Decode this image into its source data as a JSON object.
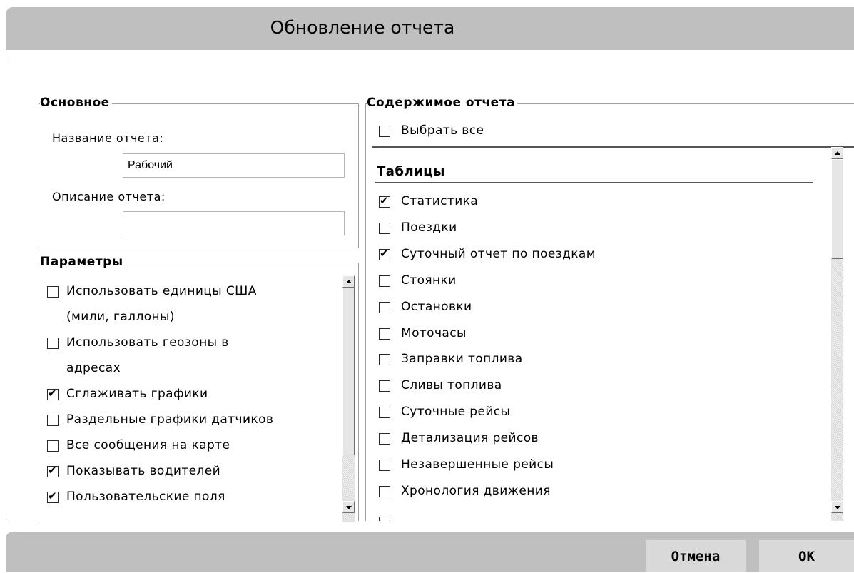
{
  "dialog": {
    "title": "Обновление отчета"
  },
  "basic": {
    "legend": "Основное",
    "name_label": "Название отчета:",
    "name_value": "Рабочий",
    "desc_label": "Описание отчета:",
    "desc_value": ""
  },
  "params": {
    "legend": "Параметры",
    "items": [
      {
        "label": "Использовать единицы США",
        "label2": "(мили, галлоны)",
        "checked": false
      },
      {
        "label": "Использовать геозоны в",
        "label2": "адресах",
        "checked": false
      },
      {
        "label": "Сглаживать графики",
        "checked": true
      },
      {
        "label": "Раздельные графики датчиков",
        "checked": false
      },
      {
        "label": "Все сообщения на карте",
        "checked": false
      },
      {
        "label": "Показывать водителей",
        "checked": true
      },
      {
        "label": "Пользовательские поля",
        "checked": true
      }
    ]
  },
  "content": {
    "legend": "Содержимое отчета",
    "select_all": {
      "label": "Выбрать все",
      "checked": false
    },
    "tables_heading": "Таблицы",
    "items": [
      {
        "label": "Статистика",
        "checked": true
      },
      {
        "label": "Поездки",
        "checked": false
      },
      {
        "label": "Суточный отчет по поездкам",
        "checked": true
      },
      {
        "label": "Стоянки",
        "checked": false
      },
      {
        "label": "Остановки",
        "checked": false
      },
      {
        "label": "Моточасы",
        "checked": false
      },
      {
        "label": "Заправки топлива",
        "checked": false
      },
      {
        "label": "Сливы топлива",
        "checked": false
      },
      {
        "label": "Суточные рейсы",
        "checked": false
      },
      {
        "label": "Детализация рейсов",
        "checked": false
      },
      {
        "label": "Незавершенные рейсы",
        "checked": false
      },
      {
        "label": "Хронология движения",
        "checked": false
      }
    ]
  },
  "footer": {
    "cancel_label": "Отмена",
    "ok_label": "OK"
  }
}
